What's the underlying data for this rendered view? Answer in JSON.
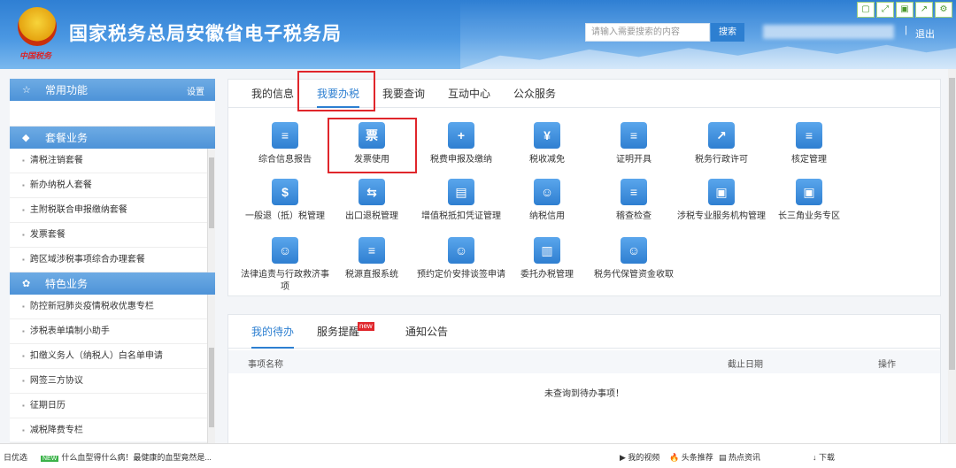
{
  "header": {
    "title": "国家税务总局安徽省电子税务局",
    "emblem_label": "中国税务",
    "search_placeholder": "请输入需要搜索的内容",
    "search_button": "搜索",
    "separator": "|",
    "logout": "退出",
    "top_icons": [
      "window-icon",
      "expand-icon",
      "save-icon",
      "export-icon",
      "settings-icon"
    ]
  },
  "sidebar": {
    "common": {
      "title": "常用功能",
      "setting": "设置"
    },
    "package": {
      "title": "套餐业务",
      "items": [
        "清税注销套餐",
        "新办纳税人套餐",
        "主附税联合申报缴纳套餐",
        "发票套餐",
        "跨区域涉税事项综合办理套餐"
      ]
    },
    "special": {
      "title": "特色业务",
      "items": [
        "防控新冠肺炎疫情税收优惠专栏",
        "涉税表单填制小助手",
        "扣缴义务人（纳税人）白名单申请",
        "网签三方协议",
        "征期日历",
        "减税降费专栏"
      ]
    }
  },
  "tabs": [
    "我的信息",
    "我要办税",
    "我要查询",
    "互动中心",
    "公众服务"
  ],
  "grid": [
    [
      {
        "label": "综合信息报告",
        "icon": "report-icon",
        "glyph": "≡"
      },
      {
        "label": "发票使用",
        "icon": "invoice-icon",
        "glyph": "票"
      },
      {
        "label": "税费申报及缴纳",
        "icon": "declare-icon",
        "glyph": "+"
      },
      {
        "label": "税收减免",
        "icon": "reduce-icon",
        "glyph": "¥"
      },
      {
        "label": "证明开具",
        "icon": "certificate-icon",
        "glyph": "≡"
      },
      {
        "label": "税务行政许可",
        "icon": "permit-icon",
        "glyph": "↗"
      },
      {
        "label": "核定管理",
        "icon": "verify-icon",
        "glyph": "≡"
      }
    ],
    [
      {
        "label": "一般退（抵）税管理",
        "icon": "refund-icon",
        "glyph": "$"
      },
      {
        "label": "出口退税管理",
        "icon": "export-refund-icon",
        "glyph": "⇆"
      },
      {
        "label": "增值税抵扣凭证管理",
        "icon": "vat-icon",
        "glyph": "▤"
      },
      {
        "label": "纳税信用",
        "icon": "credit-icon",
        "glyph": "☺"
      },
      {
        "label": "稽查检查",
        "icon": "inspect-icon",
        "glyph": "≡"
      },
      {
        "label": "涉税专业服务机构管理",
        "icon": "agency-icon",
        "glyph": "▣"
      },
      {
        "label": "长三角业务专区",
        "icon": "yangtze-icon",
        "glyph": "▣"
      }
    ],
    [
      {
        "label": "法律追责与行政救济事项",
        "icon": "law-icon",
        "glyph": "☺"
      },
      {
        "label": "税源直报系统",
        "icon": "direct-report-icon",
        "glyph": "≡"
      },
      {
        "label": "预约定价安排谈签申请",
        "icon": "pricing-icon",
        "glyph": "☺"
      },
      {
        "label": "委托办税管理",
        "icon": "entrust-icon",
        "glyph": "▥"
      },
      {
        "label": "税务代保管资金收取",
        "icon": "custody-icon",
        "glyph": "☺"
      }
    ]
  ],
  "bottom": {
    "tabs": [
      "我的待办",
      "服务提醒",
      "通知公告"
    ],
    "badge": "new",
    "columns": [
      "事项名称",
      "截止日期",
      "操作"
    ],
    "empty": "未查询到待办事项！"
  },
  "statusbar": {
    "left": "日优选",
    "new_tag": "NEW",
    "news": "什么血型得什么病！最健康的血型竟然是...",
    "items": [
      "我的视频",
      "头条推荐",
      "热点资讯",
      "下载"
    ]
  }
}
